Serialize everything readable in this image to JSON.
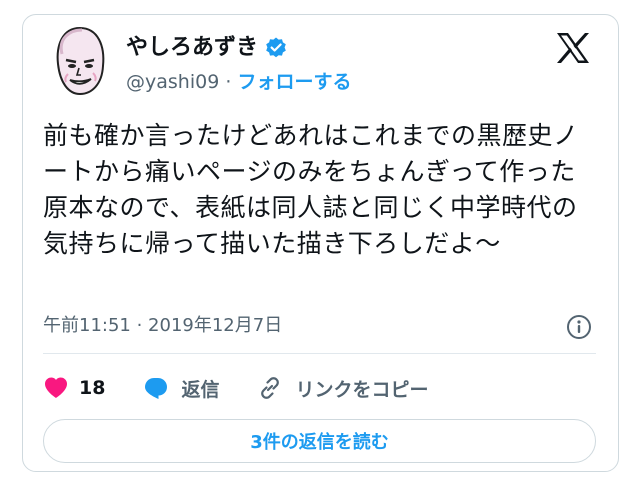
{
  "author": {
    "display_name": "やしろあずき",
    "handle": "@yashi09",
    "separator": "·",
    "follow_label": "フォローする",
    "verified": true
  },
  "tweet": {
    "text": "前も確か言ったけどあれはこれまでの黒歴史ノートから痛いページのみをちょんぎって作った原本なので、表紙は同人誌と同じく中学時代の気持ちに帰って描いた描き下ろしだよ～",
    "timestamp": "午前11:51 · 2019年12月7日"
  },
  "actions": {
    "like_count": "18",
    "reply_label": "返信",
    "copy_link_label": "リンクをコピー"
  },
  "read_replies_label": "3件の返信を読む",
  "colors": {
    "accent": "#1d9bf0",
    "like": "#f91880",
    "text": "#0f1419",
    "muted": "#536471",
    "border": "#cfd9de"
  },
  "icons": {
    "verified": "verified-badge-icon",
    "platform": "x-logo-icon",
    "info": "info-icon",
    "like": "heart-icon",
    "reply": "speech-bubble-icon",
    "copy_link": "link-icon"
  }
}
